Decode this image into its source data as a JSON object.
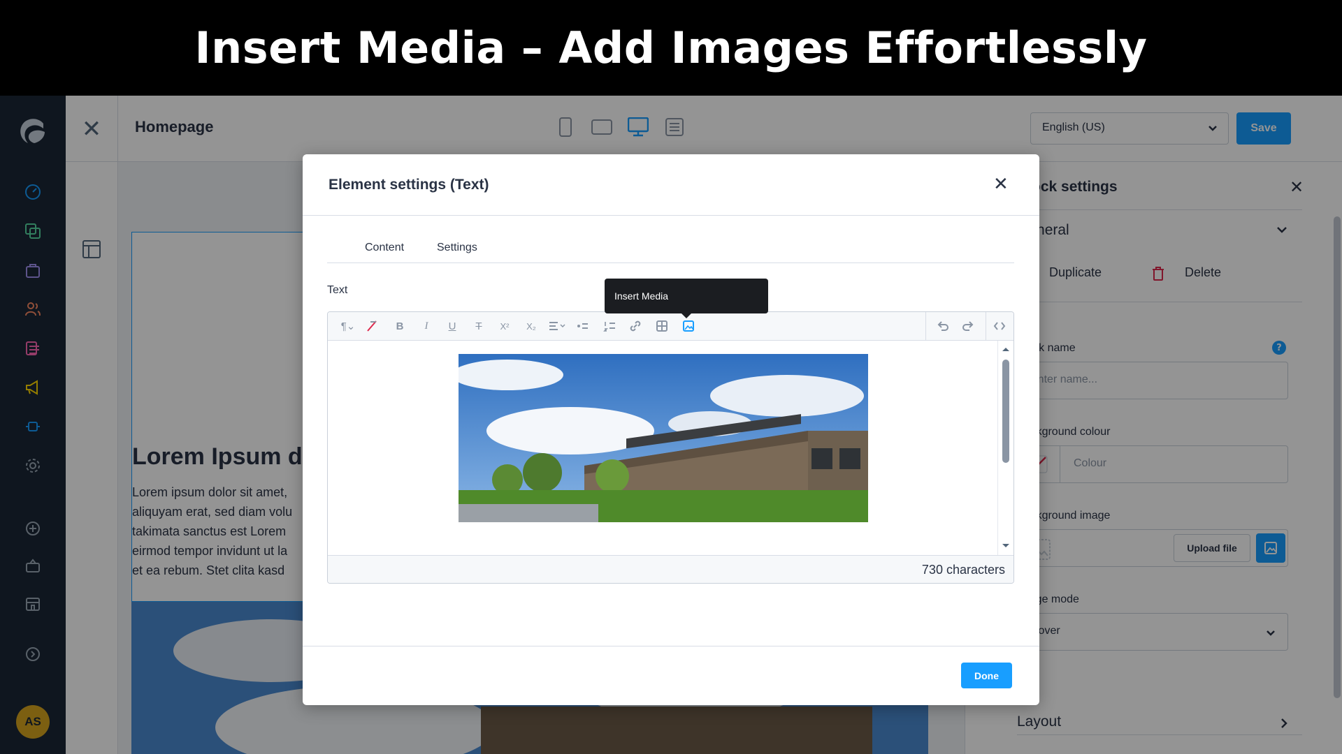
{
  "banner": {
    "title": "Insert Media – Add Images Effortlessly"
  },
  "colors": {
    "accent": "#189eff",
    "sidebar": "#1b2736",
    "avatar": "#d6a41e"
  },
  "rail": {
    "icons": [
      "dashboard-icon",
      "catalogues-icon",
      "orders-icon",
      "customers-icon",
      "content-icon",
      "marketing-icon",
      "extensions-icon",
      "settings-icon",
      "add-icon",
      "market-icon",
      "store-icon",
      "help-icon"
    ],
    "avatar_initials": "AS"
  },
  "topbar": {
    "page_title": "Homepage",
    "language": "English (US)",
    "save_label": "Save"
  },
  "canvas": {
    "heading": "Lorem Ipsum dc",
    "paragraph": "Lorem ipsum dolor sit amet,\naliquyam erat, sed diam volu\ntakimata sanctus est Lorem\neirmod tempor invidunt ut la\net ea rebum. Stet clita kasd"
  },
  "block_settings": {
    "title": "Block settings",
    "section_general": "General",
    "duplicate_label": "Duplicate",
    "delete_label": "Delete",
    "block_name_label": "Block name",
    "block_name_placeholder": "Enter name...",
    "help_glyph": "?",
    "bg_colour_label": "Background colour",
    "colour_placeholder": "Colour",
    "bg_image_label": "Background image",
    "upload_label": "Upload file",
    "image_mode_label": "Image mode",
    "image_mode_value": "Cover",
    "layout_label": "Layout"
  },
  "modal": {
    "title": "Element settings (Text)",
    "tabs": [
      {
        "label": "Content"
      },
      {
        "label": "Settings"
      }
    ],
    "text_label": "Text",
    "tooltip": "Insert Media",
    "char_count": "730 characters",
    "done_label": "Done",
    "toolbar_glyphs": {
      "bold": "B",
      "italic": "I",
      "underline": "U",
      "strike": "T",
      "superscript": "X²",
      "subscript": "X₂"
    }
  }
}
